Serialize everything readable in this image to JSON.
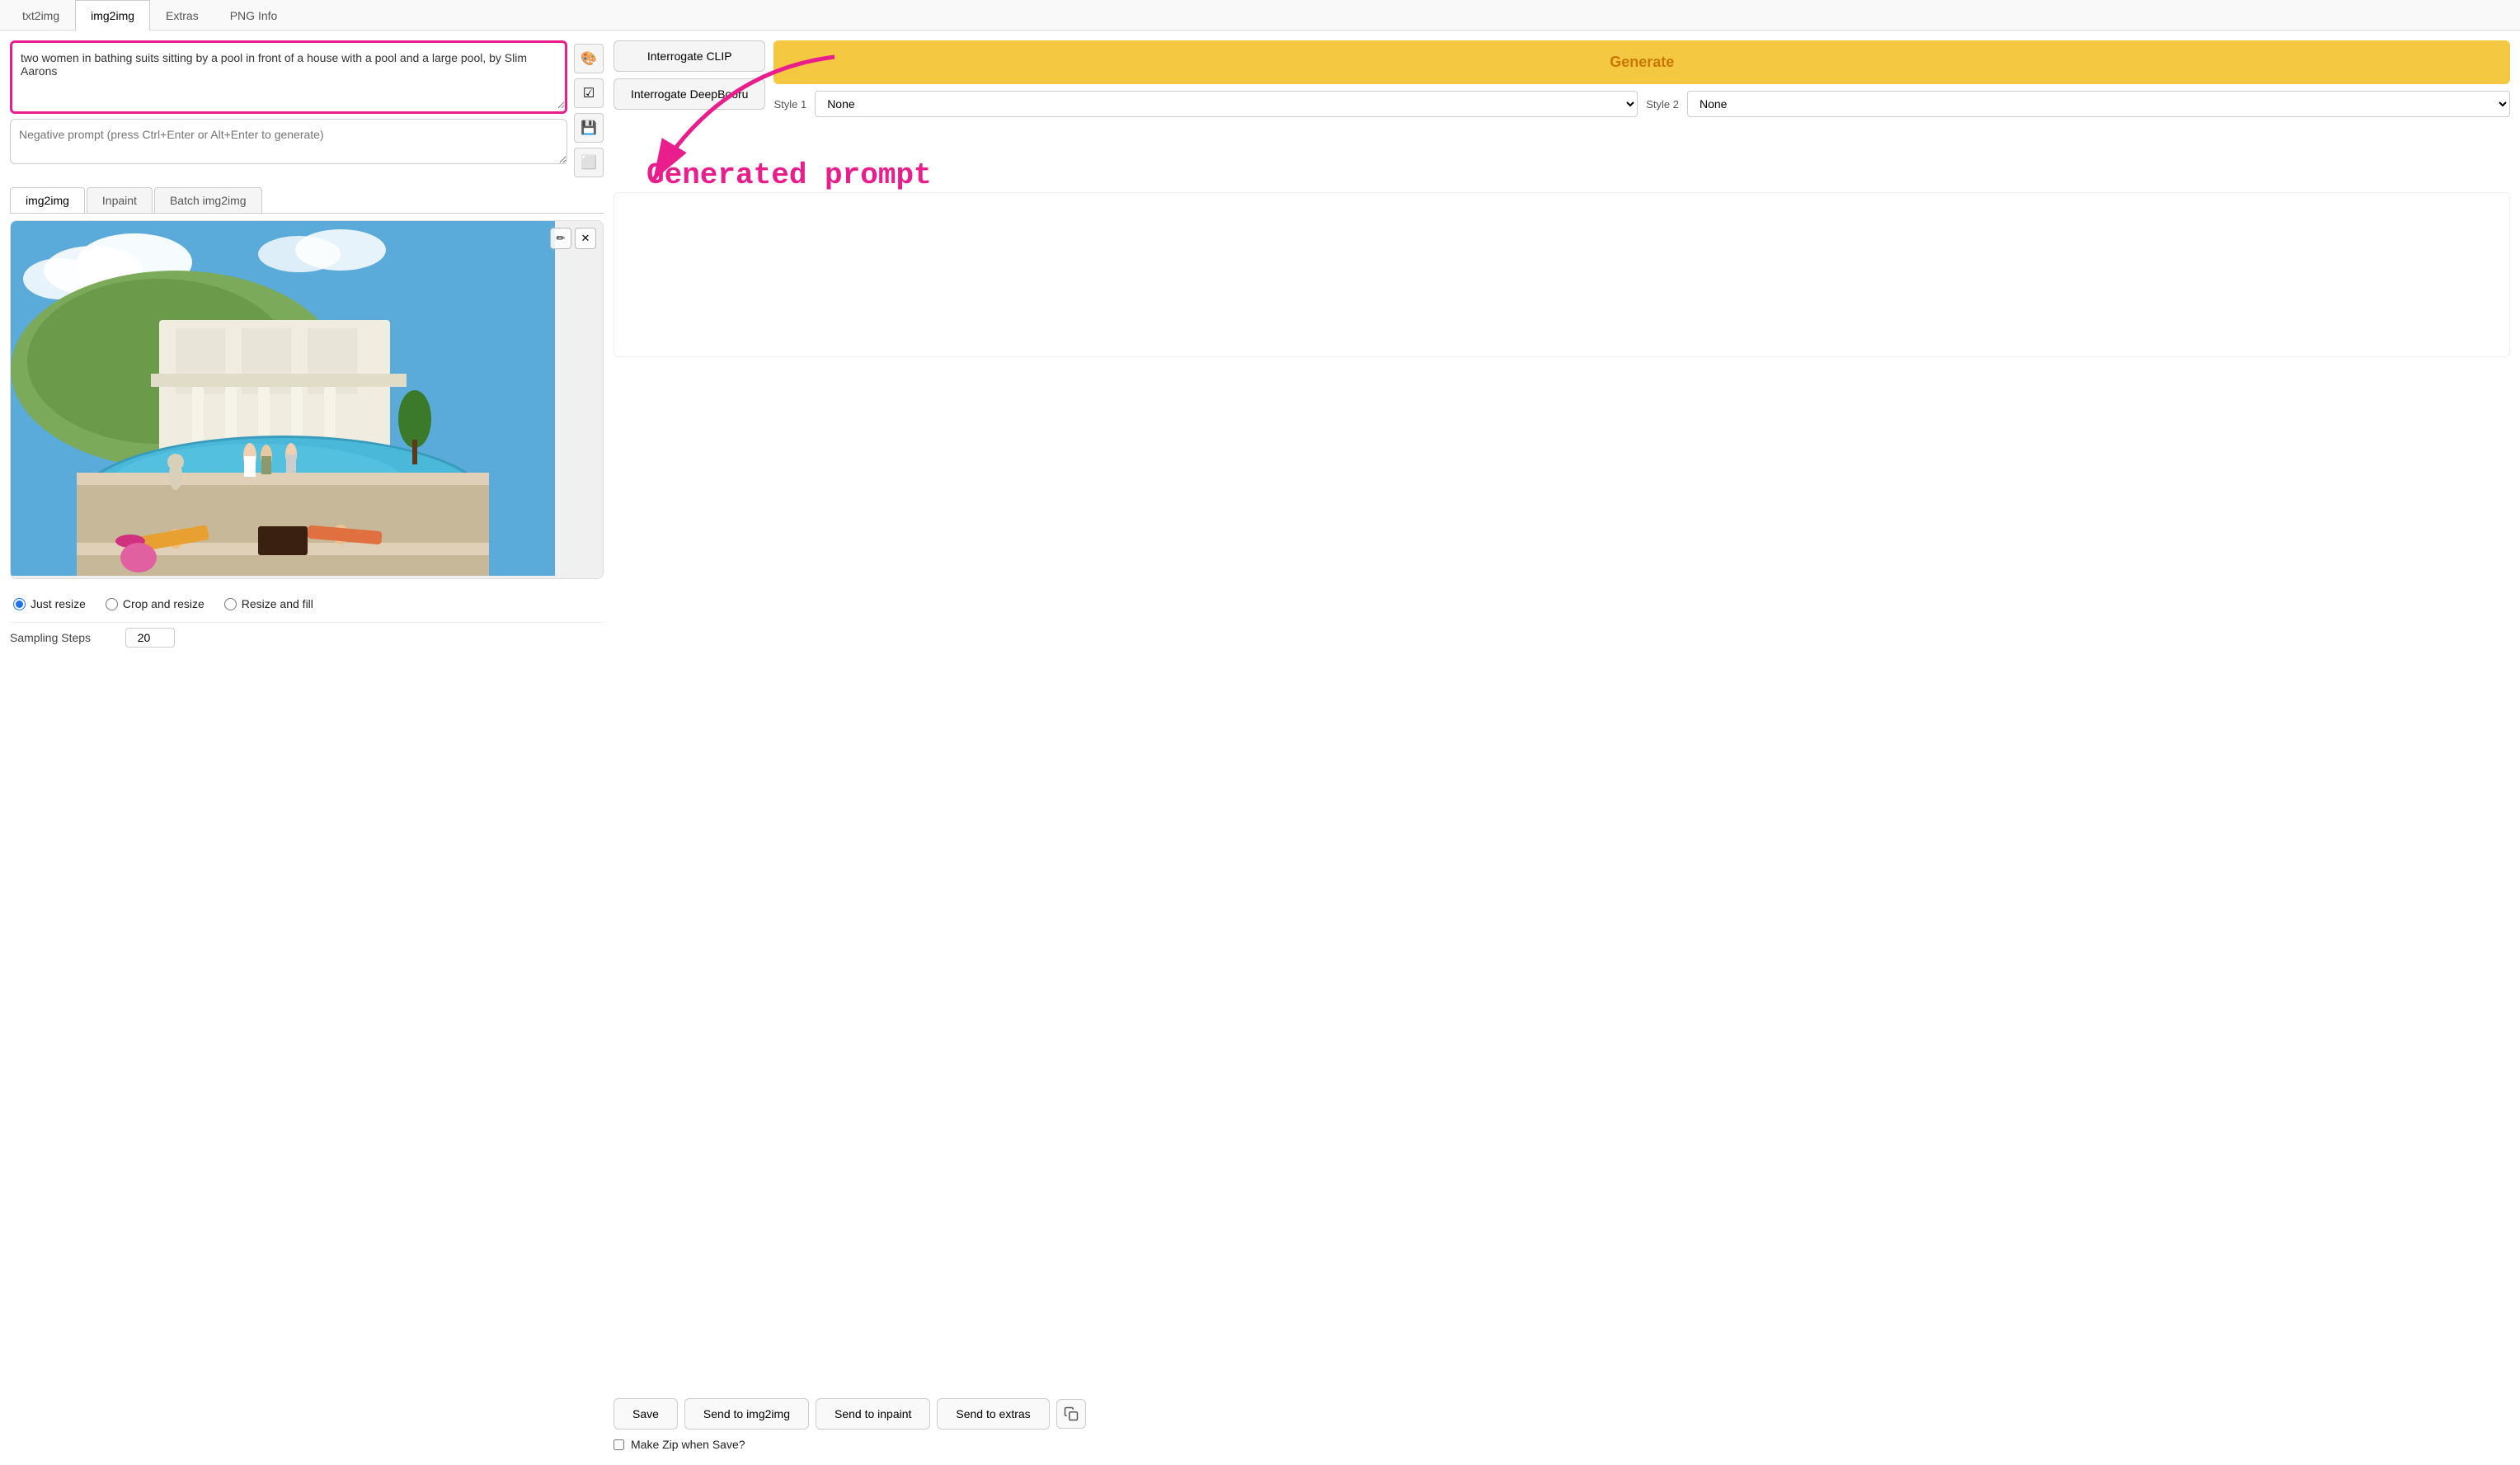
{
  "tabs": {
    "top": [
      {
        "id": "txt2img",
        "label": "txt2img",
        "active": false
      },
      {
        "id": "img2img",
        "label": "img2img",
        "active": true
      },
      {
        "id": "extras",
        "label": "Extras",
        "active": false
      },
      {
        "id": "png_info",
        "label": "PNG Info",
        "active": false
      }
    ],
    "inner": [
      {
        "id": "img2img",
        "label": "img2img",
        "active": true
      },
      {
        "id": "inpaint",
        "label": "Inpaint",
        "active": false
      },
      {
        "id": "batch",
        "label": "Batch img2img",
        "active": false
      }
    ]
  },
  "prompt": {
    "positive": "two women in bathing suits sitting by a pool in front of a house with a pool and a large pool, by Slim Aarons",
    "negative_placeholder": "Negative prompt (press Ctrl+Enter or Alt+Enter to generate)"
  },
  "side_icons": [
    "🎨",
    "☑",
    "💾",
    "⬜"
  ],
  "interrogate": {
    "clip_label": "Interrogate CLIP",
    "deepbooru_label": "Interrogate DeepBooru"
  },
  "generate": {
    "label": "Generate"
  },
  "styles": {
    "style1_label": "Style 1",
    "style2_label": "Style 2",
    "style1_value": "None",
    "style2_value": "None",
    "options": [
      "None"
    ]
  },
  "annotation": {
    "generated_prompt": "Generated prompt"
  },
  "resize_options": [
    {
      "id": "just_resize",
      "label": "Just resize",
      "checked": true
    },
    {
      "id": "crop_resize",
      "label": "Crop and resize",
      "checked": false
    },
    {
      "id": "resize_fill",
      "label": "Resize and fill",
      "checked": false
    }
  ],
  "sampling": {
    "label": "Sampling Steps",
    "value": "20"
  },
  "action_buttons": [
    {
      "id": "save",
      "label": "Save"
    },
    {
      "id": "send_img2img",
      "label": "Send to img2img"
    },
    {
      "id": "send_inpaint",
      "label": "Send to inpaint"
    },
    {
      "id": "send_extras",
      "label": "Send to extras"
    }
  ],
  "make_zip": {
    "label": "Make Zip when Save?",
    "checked": false
  },
  "image_controls": [
    {
      "id": "edit",
      "icon": "✏"
    },
    {
      "id": "close",
      "icon": "✕"
    }
  ]
}
